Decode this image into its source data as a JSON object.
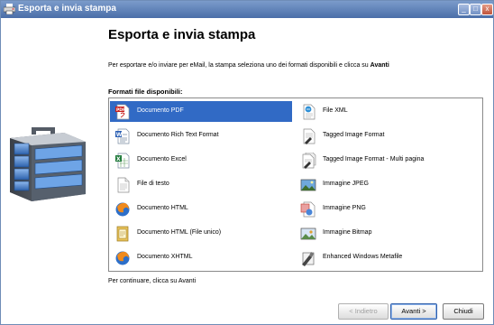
{
  "window": {
    "title": "Esporta e invia stampa",
    "controls": {
      "minimize": "_",
      "maximize": "□",
      "close": "x"
    }
  },
  "main": {
    "heading": "Esporta e invia stampa",
    "instruction_prefix": "Per esportare e/o inviare per eMail, la stampa seleziona uno dei formati disponibili e clicca su ",
    "instruction_emphasis": "Avanti",
    "formats_label": "Formati file disponibili:",
    "footer_text": "Per continuare, clicca su Avanti"
  },
  "formats": {
    "left": [
      {
        "label": "Documento PDF",
        "icon": "pdf-icon",
        "selected": true
      },
      {
        "label": "Documento Rich Text Format",
        "icon": "rtf-document-icon"
      },
      {
        "label": "Documento Excel",
        "icon": "excel-icon"
      },
      {
        "label": "File di testo",
        "icon": "text-file-icon"
      },
      {
        "label": "Documento HTML",
        "icon": "html-browser-icon"
      },
      {
        "label": "Documento HTML (File unico)",
        "icon": "html-single-file-icon"
      },
      {
        "label": "Documento XHTML",
        "icon": "xhtml-browser-icon"
      }
    ],
    "right": [
      {
        "label": "File XML",
        "icon": "xml-file-icon"
      },
      {
        "label": "Tagged Image Format",
        "icon": "tiff-icon"
      },
      {
        "label": "Tagged Image Format - Multi pagina",
        "icon": "tiff-multipage-icon"
      },
      {
        "label": "Immagine JPEG",
        "icon": "jpeg-image-icon"
      },
      {
        "label": "Immagine PNG",
        "icon": "png-image-icon"
      },
      {
        "label": "Immagine Bitmap",
        "icon": "bitmap-image-icon"
      },
      {
        "label": "Enhanced Windows Metafile",
        "icon": "metafile-icon"
      }
    ]
  },
  "buttons": {
    "back": "< Indietro",
    "next": "Avanti >",
    "close": "Chiudi"
  },
  "colors": {
    "titlebar": "#4a6ea8",
    "selection": "#316ac5",
    "briefcase_blue": "#3d7fd0"
  }
}
